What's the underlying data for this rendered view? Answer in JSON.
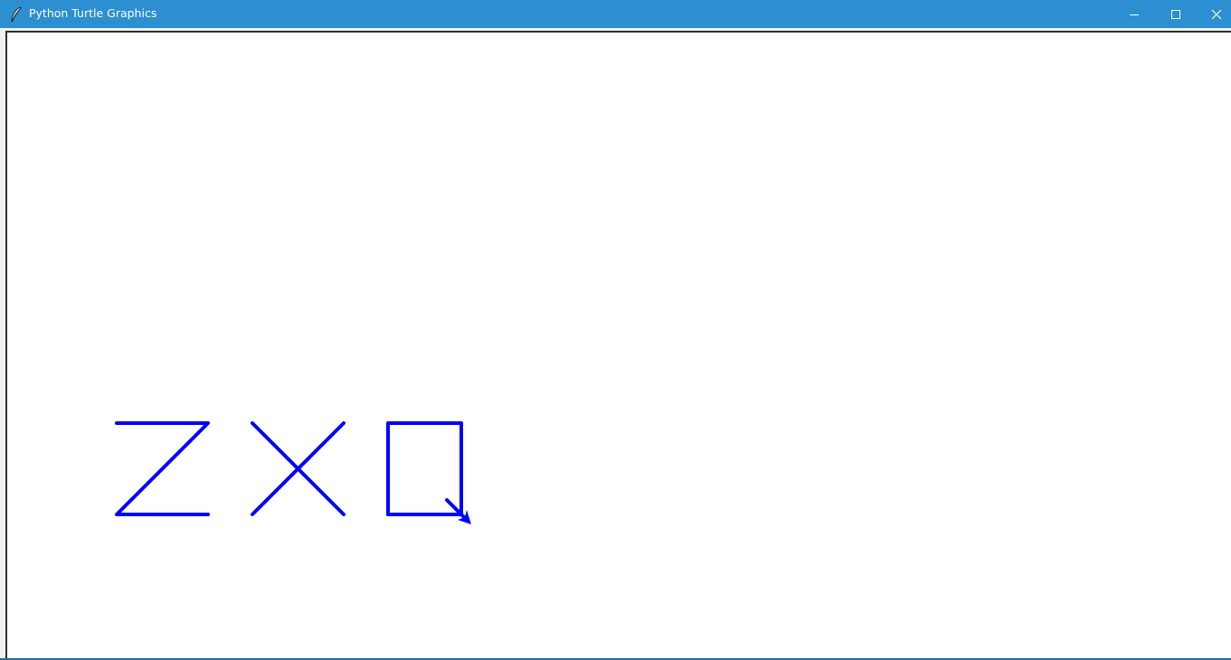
{
  "window": {
    "title": "Python Turtle Graphics",
    "app_icon": "feather-icon",
    "controls": {
      "minimize": "minimize-icon",
      "maximize": "maximize-icon",
      "close": "close-icon"
    }
  },
  "colors": {
    "titlebar": "#2b8fd1",
    "canvas": "#ffffff",
    "pen": "#0000ff"
  },
  "drawing": {
    "letters": [
      "Z",
      "X",
      "Q"
    ],
    "turtle_cursor": "arrow"
  }
}
